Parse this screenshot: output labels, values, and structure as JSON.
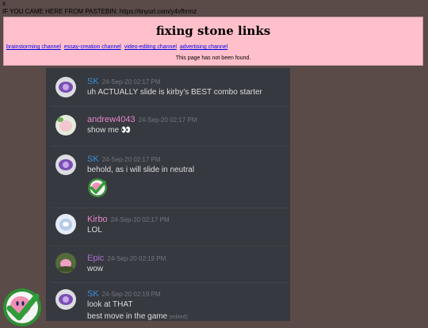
{
  "top": {
    "close": "x",
    "notice": "IF YOU CAME HERE FROM PASTEBIN: https://tinyurl.com/y4vfhrmz"
  },
  "banner": {
    "title": "fixing stone links",
    "links": [
      "brainstorming channel",
      "essay-creation channel",
      "video-editing channel",
      "advertising channel"
    ],
    "status": "This page has not been found."
  },
  "messages": [
    {
      "user": "SK",
      "time": "24-Sep-20 02:17 PM",
      "text": "uh ACTUALLY slide is kirby's BEST combo starter",
      "color": "#3a8ed8"
    },
    {
      "user": "andrew4043",
      "time": "24-Sep-20 02:17 PM",
      "text": "show me",
      "emoji": "👀",
      "color": "#e685c8"
    },
    {
      "user": "SK",
      "time": "24-Sep-20 02:17 PM",
      "text": "behold, as i will slide in neutral",
      "color": "#3a8ed8"
    },
    {
      "user": "Kirbo",
      "time": "24-Sep-20 02:17 PM",
      "text": "LOL",
      "color": "#e685c8"
    },
    {
      "user": "Epic",
      "time": "24-Sep-20 02:19 PM",
      "text": "wow",
      "color": "#a970d0"
    },
    {
      "user": "SK",
      "time": "24-Sep-20 02:19 PM",
      "text": "look at THAT",
      "text2": "best move in the game",
      "edited": "(edited)",
      "color": "#3a8ed8"
    }
  ]
}
